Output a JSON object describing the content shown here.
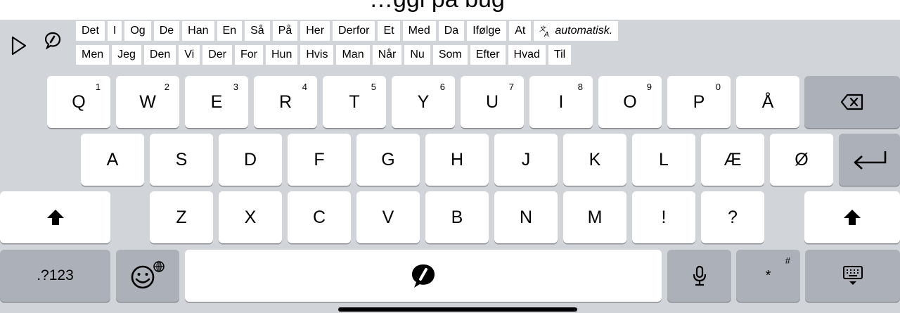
{
  "top_partial_text": "…ggi pa bug",
  "predictions": {
    "row1": [
      "Det",
      "I",
      "Og",
      "De",
      "Han",
      "En",
      "Så",
      "På",
      "Her",
      "Derfor",
      "Et",
      "Med",
      "Da",
      "Ifølge",
      "At"
    ],
    "auto_label": "automatisk.",
    "row2": [
      "Men",
      "Jeg",
      "Den",
      "Vi",
      "Der",
      "For",
      "Hun",
      "Hvis",
      "Man",
      "Når",
      "Nu",
      "Som",
      "Efter",
      "Hvad",
      "Til"
    ]
  },
  "keyboard": {
    "row1": [
      {
        "label": "Q",
        "sup": "1"
      },
      {
        "label": "W",
        "sup": "2"
      },
      {
        "label": "E",
        "sup": "3"
      },
      {
        "label": "R",
        "sup": "4"
      },
      {
        "label": "T",
        "sup": "5"
      },
      {
        "label": "Y",
        "sup": "6"
      },
      {
        "label": "U",
        "sup": "7"
      },
      {
        "label": "I",
        "sup": "8"
      },
      {
        "label": "O",
        "sup": "9"
      },
      {
        "label": "P",
        "sup": "0"
      },
      {
        "label": "Å",
        "sup": ""
      }
    ],
    "row2": [
      "A",
      "S",
      "D",
      "F",
      "G",
      "H",
      "J",
      "K",
      "L",
      "Æ",
      "Ø"
    ],
    "row3": [
      "Z",
      "X",
      "C",
      "V",
      "B",
      "N",
      "M",
      "!",
      "?"
    ],
    "numbers_label": ".?123",
    "symbols_label": "*",
    "symbols_sup": "#"
  },
  "icons": {
    "play": "play-icon",
    "speech": "speech-bubble-icon",
    "translate": "translate-icon",
    "backspace": "backspace-icon",
    "enter": "return-icon",
    "shift": "shift-icon",
    "emoji": "emoji-globe-icon",
    "mic": "microphone-icon",
    "hide": "keyboard-hide-icon"
  }
}
